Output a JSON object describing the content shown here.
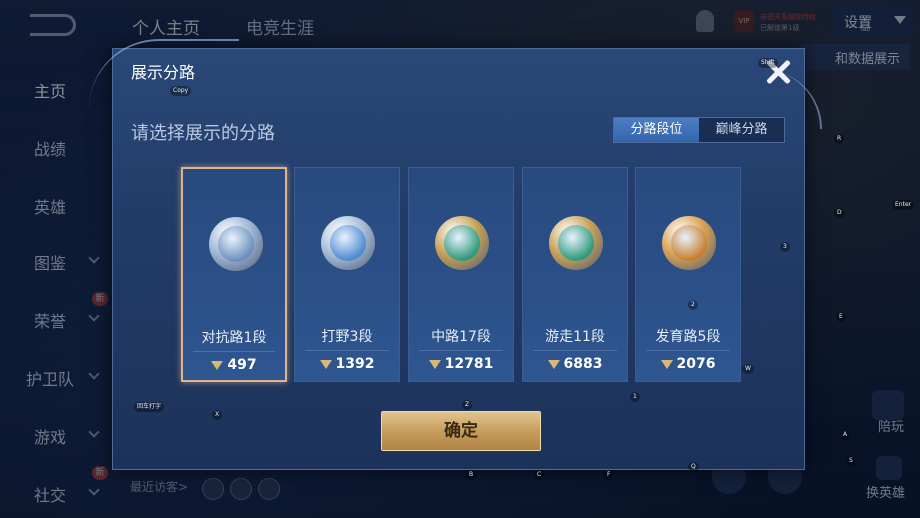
{
  "topbar": {
    "tabs": [
      "个人主页",
      "电竞生涯"
    ],
    "vip_line1": "亲密关系解锁特权",
    "vip_line2": "已解锁第1级",
    "settings_label": "设置",
    "settings_key": "Tab",
    "data_button": "和数据展示"
  },
  "sidebar": {
    "items": [
      "主页",
      "战绩",
      "英雄",
      "图鉴",
      "荣誉",
      "护卫队",
      "游戏",
      "社交"
    ],
    "new_badge": "新"
  },
  "visitors_label": "最近访客>",
  "right_panel": {
    "hero_label": "换英雄",
    "voice_label": "陪玩"
  },
  "keyhints": [
    "Copy",
    "Shift",
    "R",
    "D",
    "Enter",
    "3",
    "2",
    "E",
    "W",
    "1",
    "X",
    "回车打字",
    "B",
    "C",
    "F",
    "Q",
    "A",
    "S",
    "Z"
  ],
  "dialog": {
    "title": "展示分路",
    "subtitle": "请选择展示的分路",
    "seg_left": "分路段位",
    "seg_right": "巅峰分路",
    "confirm": "确定",
    "lanes": [
      {
        "name": "对抗路1段",
        "score": "497",
        "selected": true,
        "color": "#9fb6d6",
        "inner": "#6d8fbd"
      },
      {
        "name": "打野3段",
        "score": "1392",
        "selected": false,
        "color": "#a8bfd8",
        "inner": "#4e8bd0"
      },
      {
        "name": "中路17段",
        "score": "12781",
        "selected": false,
        "color": "#c9a258",
        "inner": "#2f9a7c"
      },
      {
        "name": "游走11段",
        "score": "6883",
        "selected": false,
        "color": "#c9a258",
        "inner": "#2f9a7c"
      },
      {
        "name": "发育路5段",
        "score": "2076",
        "selected": false,
        "color": "#d9a253",
        "inner": "#c77f2f"
      }
    ]
  }
}
